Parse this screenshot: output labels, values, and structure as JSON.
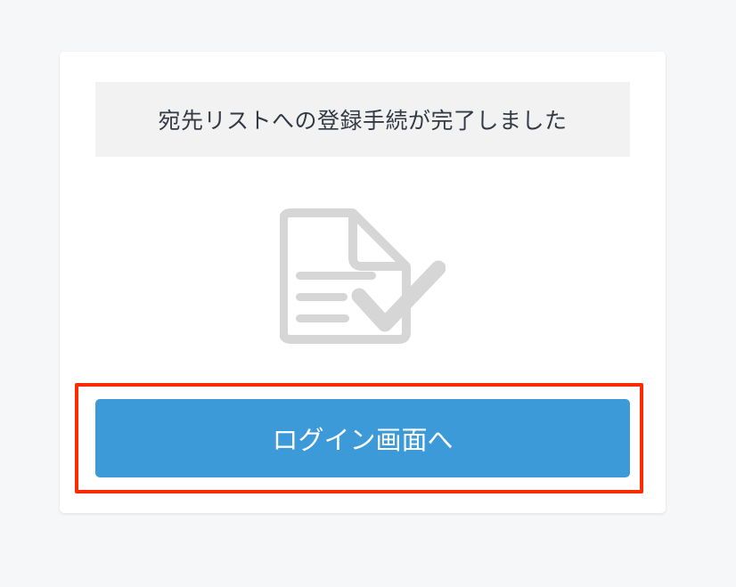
{
  "notice": {
    "message": "宛先リストへの登録手続が完了しました"
  },
  "illustration": {
    "icon": "document-check-icon",
    "color": "#d6d6d6"
  },
  "actions": {
    "login_label": "ログイン画面へ",
    "button_color": "#3d9ad9"
  },
  "annotation": {
    "highlight_color": "#ff2a00"
  }
}
